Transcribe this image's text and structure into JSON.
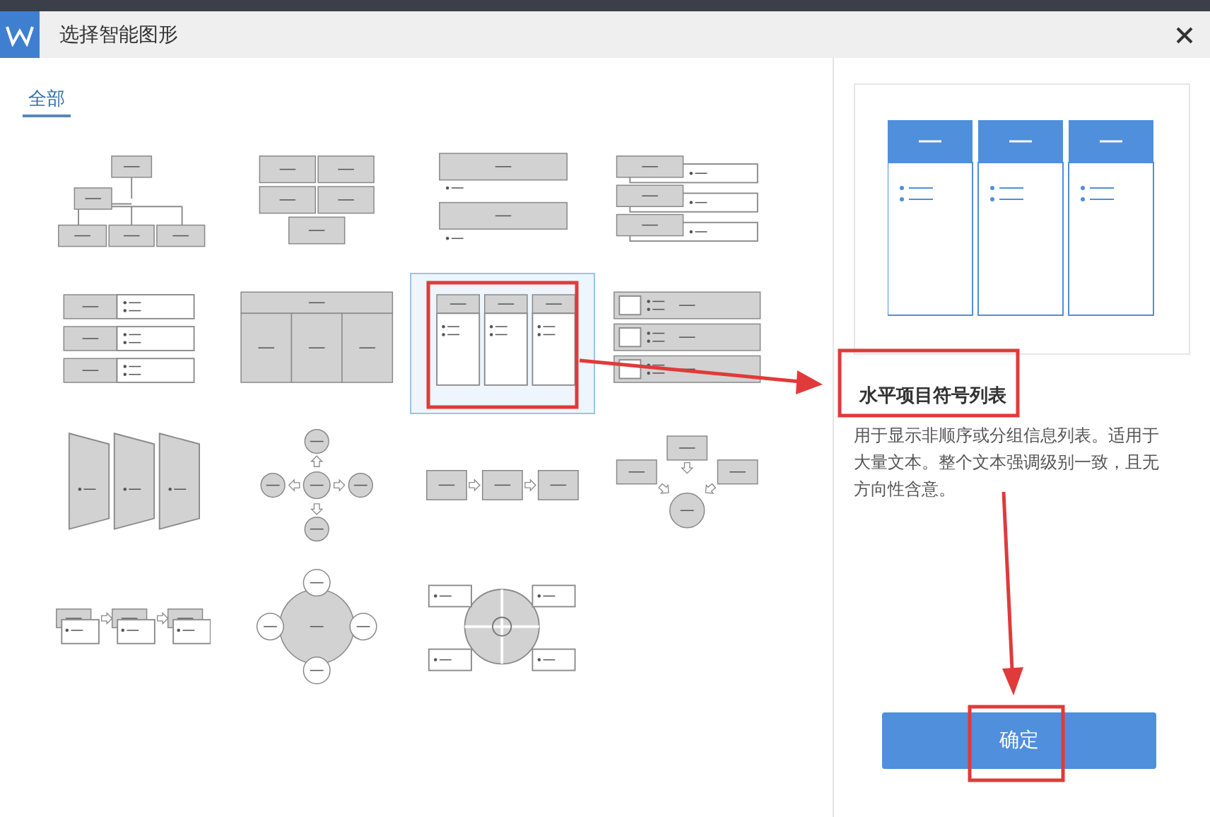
{
  "dialog": {
    "title": "选择智能图形"
  },
  "tabs": [
    {
      "label": "全部",
      "selected": true
    }
  ],
  "shapes": [
    {
      "kind": "org-chart",
      "selected": false
    },
    {
      "kind": "grid-boxes",
      "selected": false
    },
    {
      "kind": "stacked-list",
      "selected": false
    },
    {
      "kind": "bracket-list",
      "selected": false
    },
    {
      "kind": "bullet-rows",
      "selected": false
    },
    {
      "kind": "table-columns",
      "selected": false
    },
    {
      "kind": "bullet-columns",
      "selected": true
    },
    {
      "kind": "picture-list",
      "selected": false
    },
    {
      "kind": "trapezoid-list",
      "selected": false
    },
    {
      "kind": "radial-cross",
      "selected": false
    },
    {
      "kind": "process",
      "selected": false
    },
    {
      "kind": "converging",
      "selected": false
    },
    {
      "kind": "picture-process",
      "selected": false
    },
    {
      "kind": "cycle-circle",
      "selected": false
    },
    {
      "kind": "quadrant",
      "selected": false
    }
  ],
  "preview": {
    "title": "水平项目符号列表",
    "description": "用于显示非顺序或分组信息列表。适用于大量文本。整个文本强调级别一致，且无方向性含意。"
  },
  "button": {
    "label": "确定"
  }
}
